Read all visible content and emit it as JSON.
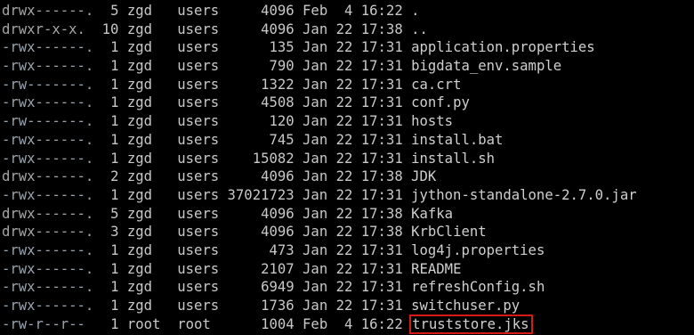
{
  "terminal": {
    "listing": [
      {
        "perm": "drwx------.",
        "links": "5",
        "owner": "zgd",
        "group": "users",
        "size": "4096",
        "month": "Feb",
        "day": "4",
        "time": "16:22",
        "name": ".",
        "dir": true
      },
      {
        "perm": "drwxr-x-x.",
        "links": "10",
        "owner": "zgd",
        "group": "users",
        "size": "4096",
        "month": "Jan",
        "day": "22",
        "time": "17:38",
        "name": "..",
        "dir": true
      },
      {
        "perm": "-rwx------.",
        "links": "1",
        "owner": "zgd",
        "group": "users",
        "size": "135",
        "month": "Jan",
        "day": "22",
        "time": "17:31",
        "name": "application.properties"
      },
      {
        "perm": "-rwx------.",
        "links": "1",
        "owner": "zgd",
        "group": "users",
        "size": "790",
        "month": "Jan",
        "day": "22",
        "time": "17:31",
        "name": "bigdata_env.sample"
      },
      {
        "perm": "-rw-------.",
        "links": "1",
        "owner": "zgd",
        "group": "users",
        "size": "1322",
        "month": "Jan",
        "day": "22",
        "time": "17:31",
        "name": "ca.crt"
      },
      {
        "perm": "-rwx------.",
        "links": "1",
        "owner": "zgd",
        "group": "users",
        "size": "4508",
        "month": "Jan",
        "day": "22",
        "time": "17:31",
        "name": "conf.py"
      },
      {
        "perm": "-rw-------.",
        "links": "1",
        "owner": "zgd",
        "group": "users",
        "size": "120",
        "month": "Jan",
        "day": "22",
        "time": "17:31",
        "name": "hosts"
      },
      {
        "perm": "-rwx------.",
        "links": "1",
        "owner": "zgd",
        "group": "users",
        "size": "745",
        "month": "Jan",
        "day": "22",
        "time": "17:31",
        "name": "install.bat"
      },
      {
        "perm": "-rwx------.",
        "links": "1",
        "owner": "zgd",
        "group": "users",
        "size": "15082",
        "month": "Jan",
        "day": "22",
        "time": "17:31",
        "name": "install.sh"
      },
      {
        "perm": "drwx------.",
        "links": "2",
        "owner": "zgd",
        "group": "users",
        "size": "4096",
        "month": "Jan",
        "day": "22",
        "time": "17:38",
        "name": "JDK",
        "dir": true
      },
      {
        "perm": "-rwx------.",
        "links": "1",
        "owner": "zgd",
        "group": "users",
        "size": "37021723",
        "month": "Jan",
        "day": "22",
        "time": "17:31",
        "name": "jython-standalone-2.7.0.jar"
      },
      {
        "perm": "drwx------.",
        "links": "5",
        "owner": "zgd",
        "group": "users",
        "size": "4096",
        "month": "Jan",
        "day": "22",
        "time": "17:38",
        "name": "Kafka",
        "dir": true
      },
      {
        "perm": "drwx------.",
        "links": "3",
        "owner": "zgd",
        "group": "users",
        "size": "4096",
        "month": "Jan",
        "day": "22",
        "time": "17:38",
        "name": "KrbClient",
        "dir": true
      },
      {
        "perm": "-rwx------.",
        "links": "1",
        "owner": "zgd",
        "group": "users",
        "size": "473",
        "month": "Jan",
        "day": "22",
        "time": "17:31",
        "name": "log4j.properties"
      },
      {
        "perm": "-rwx------.",
        "links": "1",
        "owner": "zgd",
        "group": "users",
        "size": "2107",
        "month": "Jan",
        "day": "22",
        "time": "17:31",
        "name": "README"
      },
      {
        "perm": "-rwx------.",
        "links": "1",
        "owner": "zgd",
        "group": "users",
        "size": "6949",
        "month": "Jan",
        "day": "22",
        "time": "17:31",
        "name": "refreshConfig.sh"
      },
      {
        "perm": "-rwx------.",
        "links": "1",
        "owner": "zgd",
        "group": "users",
        "size": "1736",
        "month": "Jan",
        "day": "22",
        "time": "17:31",
        "name": "switchuser.py"
      },
      {
        "perm": "-rw-r--r--",
        "links": "1",
        "owner": "root",
        "group": "root",
        "size": "1004",
        "month": "Feb",
        "day": "4",
        "time": "16:22",
        "name": "truststore.jks",
        "highlighted": true
      }
    ],
    "colors": {
      "background": "#000000",
      "text": "#c8c8c8",
      "highlight_box": "#d21c1c"
    }
  }
}
